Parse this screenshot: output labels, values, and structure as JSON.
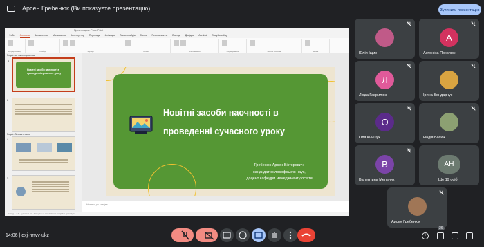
{
  "meet": {
    "presenter_bar": "Арсен Гребенюк (Ви показуєте презентацію)",
    "stop_button": "Зупинити презентацію",
    "time": "14:06",
    "meeting_code": "dxj-rmvv-ukz",
    "participants_count": "26"
  },
  "pp": {
    "title": "Презентация - PowerPoint",
    "tabs": [
      "Файл",
      "Основна",
      "Вставлення",
      "Малювання",
      "Конструктор",
      "Переходи",
      "Анімація",
      "Показ слайдів",
      "Запис",
      "Рецензування",
      "Вигляд",
      "Довідка",
      "Acrobat",
      "StoryBoarding"
    ],
    "ribbon_groups": [
      "Буфер обміну",
      "Слайди",
      "Шрифт",
      "Абзац",
      "Малювання",
      "Редагування",
      "Adobe Acrobat",
      "Мова"
    ],
    "section1": "Розділ за замовчуванням",
    "section2": "Розділ без заголовка",
    "thumb_title": "Новітні засоби наочності в проведенні сучасного уроку",
    "notes": "Нотатки до слайда",
    "status": "Слайд 1 з 11 · українська · Спеціальні можливості: потрібно дослідити"
  },
  "slide": {
    "title_line1": "Новітні засоби наочності в",
    "title_line2": "проведенні сучасного уроку",
    "author": "Гребенюк Арсен Вікторович,",
    "degree": "кандидат філософських наук,",
    "position": "доцент кафедри менеджменту освіти"
  },
  "participants": [
    {
      "name": "Юлія Іщик",
      "initial": "",
      "color": "#c05a88",
      "muted": true
    },
    {
      "name": "Антоніна Похолюк",
      "initial": "А",
      "color": "#d3325f",
      "muted": true
    },
    {
      "name": "Люда Гаврилюк",
      "initial": "Л",
      "color": "#e05a9a",
      "muted": true
    },
    {
      "name": "Ірина Бондарчук",
      "initial": "",
      "color": "#d9a441",
      "muted": true
    },
    {
      "name": "Оля Книшук",
      "initial": "О",
      "color": "#5b2b8a",
      "muted": true
    },
    {
      "name": "Надія Басюк",
      "initial": "",
      "color": "#8ca072",
      "muted": true
    },
    {
      "name": "Валентина Мельник",
      "initial": "В",
      "color": "#7b44a8",
      "muted": true
    },
    {
      "name": "Ще 19 осіб",
      "initial": "АН",
      "color": "#6c7a70",
      "muted": false
    },
    {
      "name": "Арсен Гребенюк",
      "initial": "",
      "color": "#a07656",
      "muted": true
    }
  ],
  "colors": {
    "accent": "#a8c7fa",
    "hangup": "#ea4335",
    "slide_green": "#559734",
    "ppt_accent": "#c43e1c"
  }
}
